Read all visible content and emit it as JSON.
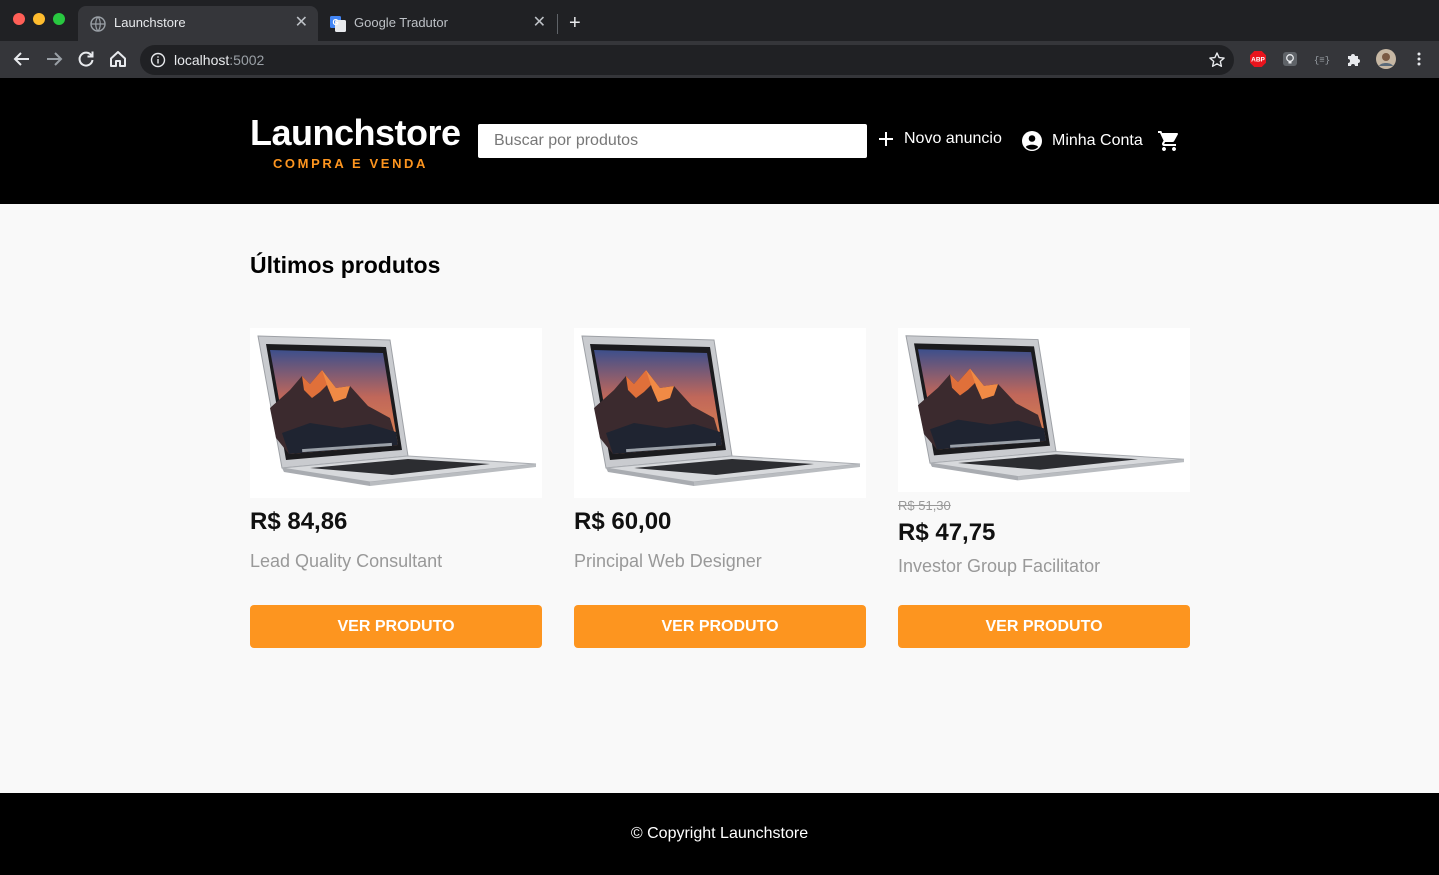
{
  "browser": {
    "tabs": [
      {
        "title": "Launchstore",
        "active": true
      },
      {
        "title": "Google Tradutor",
        "active": false
      }
    ],
    "url_host": "localhost",
    "url_port": ":5002",
    "extensions": [
      "adblock-plus-icon",
      "lightbulb-extension-icon",
      "json-viewer-icon",
      "puzzle-icon",
      "profile-avatar"
    ]
  },
  "header": {
    "logo_title": "Launchstore",
    "logo_subtitle": "COMPRA E VENDA",
    "search_placeholder": "Buscar por produtos",
    "new_ad_label": "Novo anuncio",
    "account_label": "Minha Conta"
  },
  "main": {
    "section_title": "Últimos produtos",
    "products": [
      {
        "price": "R$ 84,86",
        "old_price": "",
        "name": "Lead Quality Consultant",
        "button": "Ver produto"
      },
      {
        "price": "R$ 60,00",
        "old_price": "",
        "name": "Principal Web Designer",
        "button": "Ver produto"
      },
      {
        "price": "R$ 47,75",
        "old_price": "R$ 51,30",
        "name": "Investor Group Facilitator",
        "button": "Ver produto"
      }
    ]
  },
  "footer": {
    "copyright": "© Copyright Launchstore"
  },
  "colors": {
    "accent": "#fd951f",
    "header_bg": "#000000",
    "page_bg": "#f9f9f9"
  }
}
